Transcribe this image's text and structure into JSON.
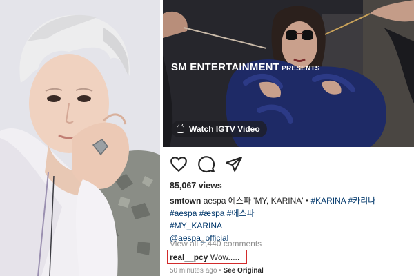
{
  "video": {
    "brand": "SM ENTERTAINMENT",
    "brand_suffix": "PRESENTS",
    "watch_button": "Watch IGTV Video"
  },
  "post": {
    "views": "85,067 views",
    "username": "smtown",
    "caption_text": "aespa 에스파 'MY, KARINA' •",
    "hashtags": [
      "#KARINA",
      "#카리나",
      "#aespa",
      "#æspa",
      "#에스파",
      "#MY_KARINA"
    ],
    "mention": "@aespa_official",
    "view_comments": "View all 2,440 comments",
    "comment": {
      "username": "real__pcy",
      "text": "Wow....."
    },
    "time_ago": "50 minutes ago",
    "separator": "•",
    "see_original": "See Original"
  },
  "icons": [
    "heart-icon",
    "comment-icon",
    "share-icon",
    "igtv-icon"
  ],
  "colors": {
    "link": "#00376b",
    "highlight_box": "#d22b2b",
    "muted": "#8e8e8e"
  }
}
